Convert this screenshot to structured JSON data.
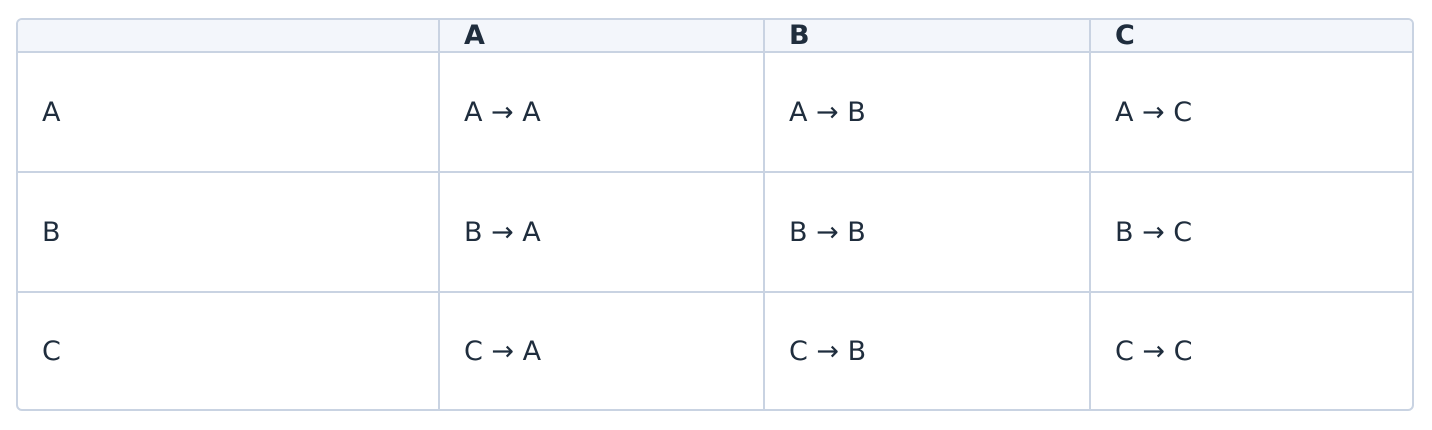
{
  "table": {
    "headers": [
      "",
      "A",
      "B",
      "C"
    ],
    "rows": [
      [
        "A",
        "A → A",
        "A → B",
        "A → C"
      ],
      [
        "B",
        "B → A",
        "B → B",
        "B → C"
      ],
      [
        "C",
        "C → A",
        "C → B",
        "C → C"
      ]
    ]
  },
  "colors": {
    "border": "#c9d3e2",
    "header_bg": "#f3f6fb",
    "text": "#1f2d3d"
  }
}
